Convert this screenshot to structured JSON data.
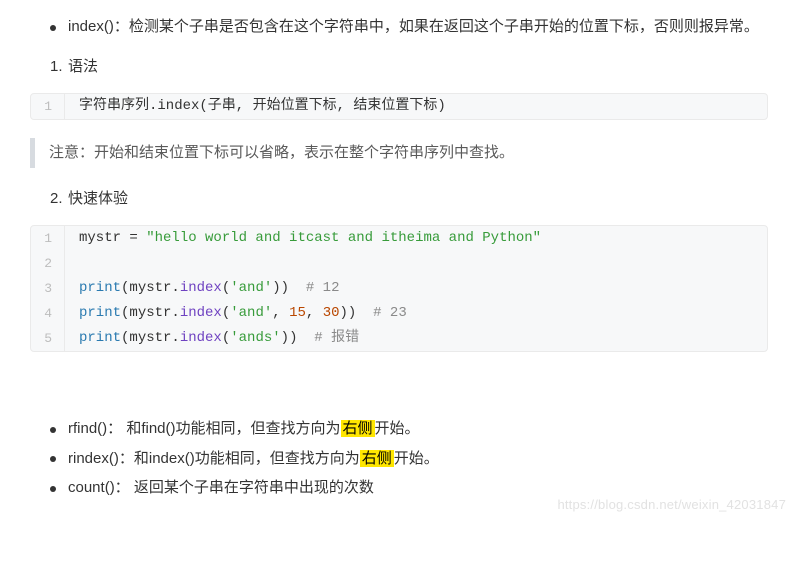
{
  "intro_bullet": "index()：检测某个子串是否包含在这个字符串中，如果在返回这个子串开始的位置下标，否则则报异常。",
  "steps": [
    {
      "num": "1.",
      "label": "语法"
    },
    {
      "num": "2.",
      "label": "快速体验"
    }
  ],
  "syntax_code": {
    "lines": [
      {
        "n": "1",
        "plain": "字符串序列.index(子串, 开始位置下标, 结束位置下标)"
      }
    ]
  },
  "note": "注意：开始和结束位置下标可以省略，表示在整个字符串序列中查找。",
  "example_code": {
    "lines": [
      {
        "n": "1",
        "tokens": [
          "mystr = ",
          {
            "cls": "str",
            "t": "\"hello world and itcast and itheima and Python\""
          }
        ]
      },
      {
        "n": "2",
        "tokens": [
          ""
        ]
      },
      {
        "n": "3",
        "tokens": [
          {
            "cls": "builtin",
            "t": "print"
          },
          "(mystr.",
          {
            "cls": "func",
            "t": "index"
          },
          "(",
          {
            "cls": "str",
            "t": "'and'"
          },
          "))  ",
          {
            "cls": "cmt",
            "t": "# 12"
          }
        ]
      },
      {
        "n": "4",
        "tokens": [
          {
            "cls": "builtin",
            "t": "print"
          },
          "(mystr.",
          {
            "cls": "func",
            "t": "index"
          },
          "(",
          {
            "cls": "str",
            "t": "'and'"
          },
          ", ",
          {
            "cls": "num-lit",
            "t": "15"
          },
          ", ",
          {
            "cls": "num-lit",
            "t": "30"
          },
          "))  ",
          {
            "cls": "cmt",
            "t": "# 23"
          }
        ]
      },
      {
        "n": "5",
        "tokens": [
          {
            "cls": "builtin",
            "t": "print"
          },
          "(mystr.",
          {
            "cls": "func",
            "t": "index"
          },
          "(",
          {
            "cls": "str",
            "t": "'ands'"
          },
          "))  ",
          {
            "cls": "cmt",
            "t": "# 报错"
          }
        ]
      }
    ]
  },
  "footer_bullets": [
    {
      "label": "rfind()：",
      "prefix": " 和find()功能相同，但查找方向为",
      "hl": "右侧",
      "suffix": "开始。"
    },
    {
      "label": "rindex()：",
      "prefix": "和index()功能相同，但查找方向为",
      "hl": "右侧",
      "suffix": "开始。"
    },
    {
      "label": "count()：",
      "prefix": " 返回某个子串在字符串中出现的次数",
      "hl": "",
      "suffix": ""
    }
  ],
  "watermark": "https://blog.csdn.net/weixin_42031847"
}
